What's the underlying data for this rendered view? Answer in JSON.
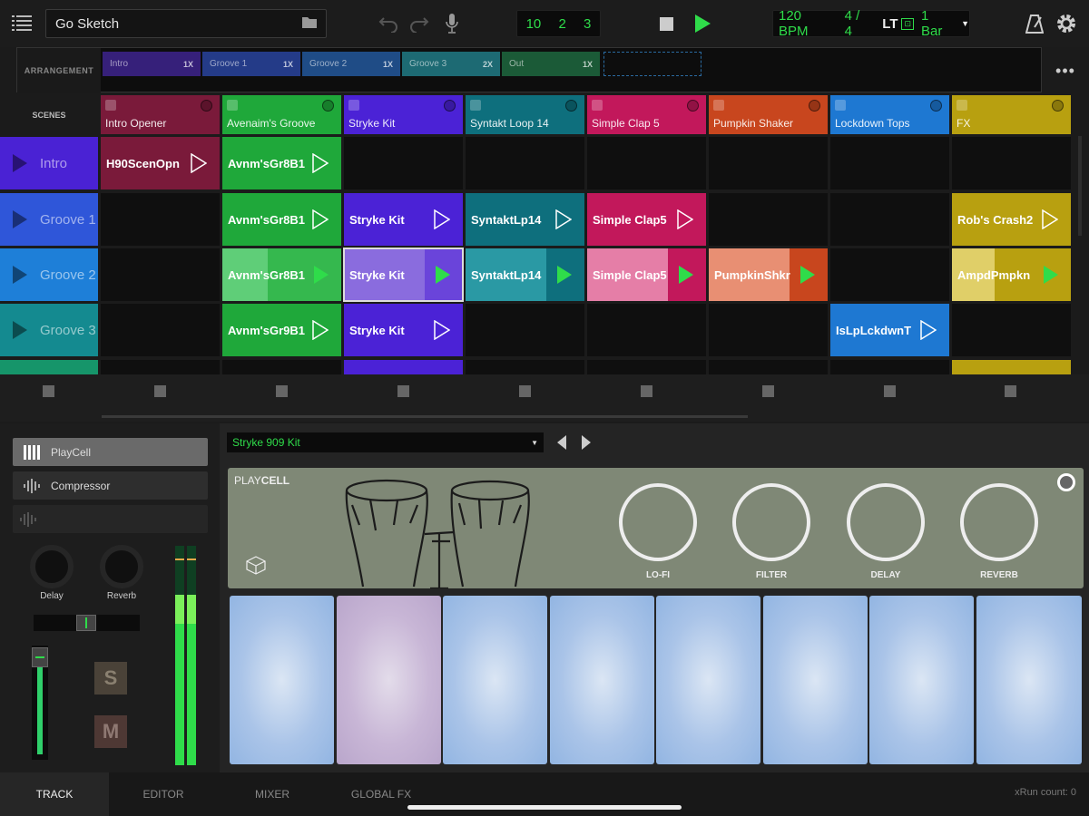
{
  "topbar": {
    "sketch_name": "Go Sketch",
    "position": {
      "bar": "10",
      "beat": "2",
      "tick": "3"
    },
    "bpm": "120 BPM",
    "time_sig": "4 / 4",
    "lt": "LT",
    "quantize": "1 Bar"
  },
  "arrangement": {
    "label": "ARRANGEMENT",
    "segments": [
      {
        "name": "Intro",
        "repeat": "1X"
      },
      {
        "name": "Groove 1",
        "repeat": "1X"
      },
      {
        "name": "Groove 2",
        "repeat": "1X"
      },
      {
        "name": "Groove 3",
        "repeat": "2X"
      },
      {
        "name": "Out",
        "repeat": "1X"
      }
    ]
  },
  "scenes_label": "SCENES",
  "tracks": [
    "Intro Opener",
    "Avenaim's Groove",
    "Stryke Kit",
    "Syntakt Loop 14",
    "Simple Clap 5",
    "Pumpkin Shaker",
    "Lockdown Tops",
    "FX"
  ],
  "scenes": [
    "Intro",
    "Groove 1",
    "Groove 2",
    "Groove 3"
  ],
  "clips": {
    "r0": [
      "H90ScenOpn",
      "Avnm'sGr8B1"
    ],
    "r1": [
      "Avnm'sGr8B1",
      "Stryke Kit",
      "SyntaktLp14",
      "Simple Clap5",
      "Rob's Crash2"
    ],
    "r2": [
      "Avnm'sGr8B1",
      "Stryke Kit",
      "SyntaktLp14",
      "Simple Clap5",
      "PumpkinShkr",
      "AmpdPmpkn"
    ],
    "r3": [
      "Avnm'sGr9B1",
      "Stryke Kit",
      "IsLpLckdwnT"
    ]
  },
  "device": {
    "preset": "Stryke 909 Kit",
    "chain": [
      "PlayCell",
      "Compressor"
    ],
    "title_a": "PLAY",
    "title_b": "CELL",
    "knobs": [
      "LO-FI",
      "FILTER",
      "DELAY",
      "REVERB"
    ]
  },
  "mixer": {
    "send1": "Delay",
    "send2": "Reverb",
    "solo": "S",
    "mute": "M"
  },
  "tabs": [
    "TRACK",
    "EDITOR",
    "MIXER",
    "GLOBAL FX"
  ],
  "status": "xRun count: 0",
  "colors": {
    "accent": "#2fdc4a",
    "t0": "#7a1a3a",
    "t1": "#1fa83a",
    "t2": "#4b22d6",
    "t3": "#0e6f7d",
    "t4": "#c2185b",
    "t5": "#c8461e",
    "t6": "#1e78d2",
    "t7": "#b8a010"
  }
}
